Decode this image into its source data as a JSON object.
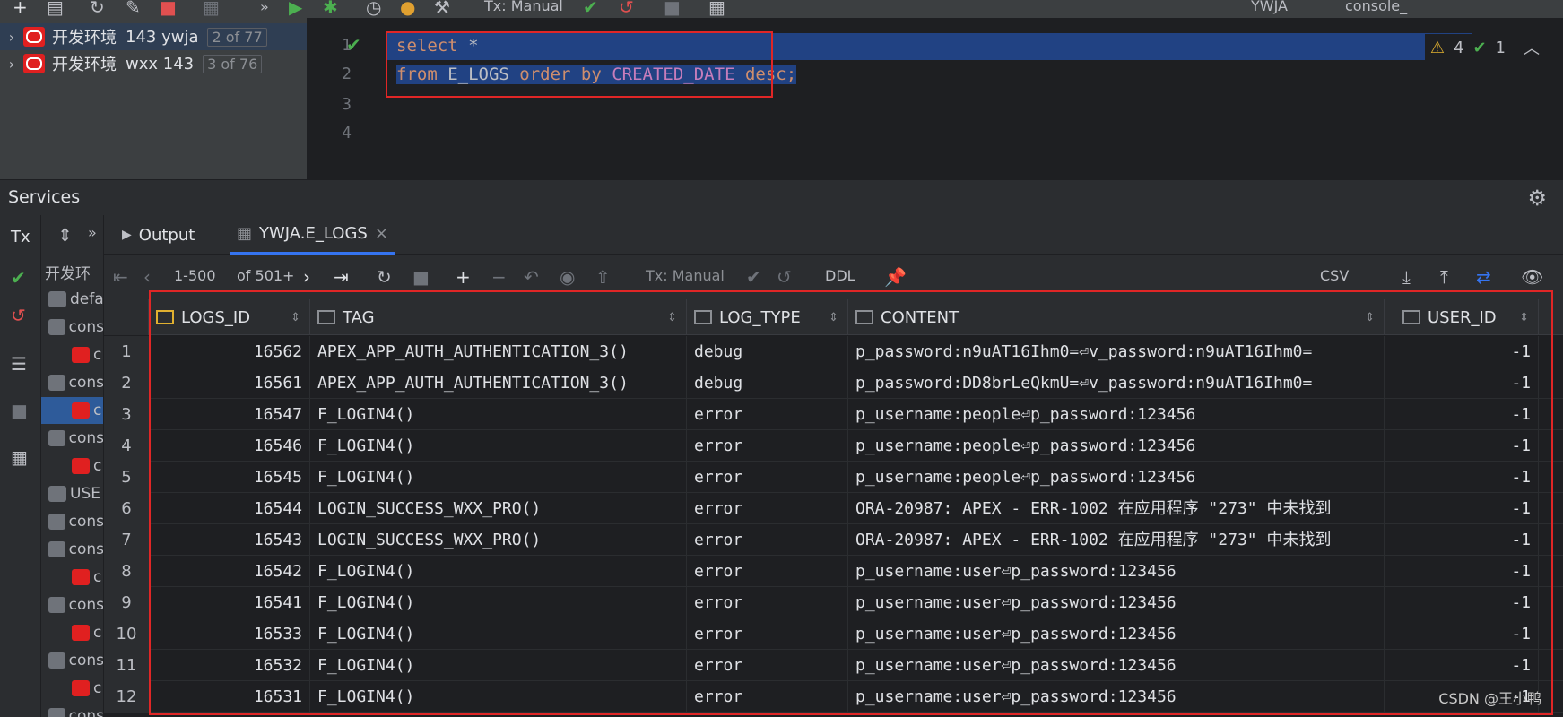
{
  "toolbar": {
    "tx_mode": "Tx: Manual",
    "schema": "YWJA",
    "console": "console_"
  },
  "datasources": [
    {
      "label": "开发环境",
      "user": "143 ywja",
      "count": "2 of 77"
    },
    {
      "label": "开发环境",
      "user": "wxx 143",
      "count": "3 of 76"
    }
  ],
  "editor": {
    "line_numbers": [
      "1",
      "2",
      "3",
      "4"
    ],
    "line1_kw": "select",
    "line1_rest": " *",
    "line2_from": "from",
    "line2_table": " E_LOGS ",
    "line2_order": "order by",
    "line2_col": " CREATED_DATE ",
    "line2_desc": "desc",
    "line2_semi": ";",
    "warnings": "4",
    "ok": "1"
  },
  "services": {
    "title": "Services",
    "tree": [
      {
        "label": "开发环",
        "kind": "text"
      },
      {
        "label": "defa",
        "kind": "plug"
      },
      {
        "label": "cons",
        "kind": "plug"
      },
      {
        "label": "c",
        "kind": "oracle"
      },
      {
        "label": "cons",
        "kind": "plug"
      },
      {
        "label": "c",
        "kind": "oracle",
        "selected": true
      },
      {
        "label": "cons",
        "kind": "plug"
      },
      {
        "label": "c",
        "kind": "oracle"
      },
      {
        "label": "USE",
        "kind": "plug"
      },
      {
        "label": "cons",
        "kind": "plug"
      },
      {
        "label": "cons",
        "kind": "plug"
      },
      {
        "label": "c",
        "kind": "oracle"
      },
      {
        "label": "cons",
        "kind": "plug"
      },
      {
        "label": "c",
        "kind": "oracle"
      },
      {
        "label": "cons",
        "kind": "plug"
      },
      {
        "label": "c",
        "kind": "oracle"
      },
      {
        "label": "cons",
        "kind": "plug"
      }
    ]
  },
  "tabs": {
    "output": "Output",
    "result": "YWJA.E_LOGS"
  },
  "result_toolbar": {
    "range": "1-500",
    "total": "of 501+",
    "tx_mode": "Tx: Manual",
    "ddl": "DDL",
    "export": "CSV"
  },
  "grid": {
    "columns": [
      "LOGS_ID",
      "TAG",
      "LOG_TYPE",
      "CONTENT",
      "USER_ID"
    ],
    "rows": [
      {
        "n": "1",
        "id": "16562",
        "tag": "APEX_APP_AUTH_AUTHENTICATION_3()",
        "type": "debug",
        "content": "p_password:n9uAT16Ihm0=⏎v_password:n9uAT16Ihm0=",
        "user": "-1"
      },
      {
        "n": "2",
        "id": "16561",
        "tag": "APEX_APP_AUTH_AUTHENTICATION_3()",
        "type": "debug",
        "content": "p_password:DD8brLeQkmU=⏎v_password:n9uAT16Ihm0=",
        "user": "-1"
      },
      {
        "n": "3",
        "id": "16547",
        "tag": "F_LOGIN4()",
        "type": "error",
        "content": "p_username:people⏎p_password:123456",
        "user": "-1"
      },
      {
        "n": "4",
        "id": "16546",
        "tag": "F_LOGIN4()",
        "type": "error",
        "content": "p_username:people⏎p_password:123456",
        "user": "-1"
      },
      {
        "n": "5",
        "id": "16545",
        "tag": "F_LOGIN4()",
        "type": "error",
        "content": "p_username:people⏎p_password:123456",
        "user": "-1"
      },
      {
        "n": "6",
        "id": "16544",
        "tag": "LOGIN_SUCCESS_WXX_PRO()",
        "type": "error",
        "content": "ORA-20987: APEX - ERR-1002 在应用程序 \"273\" 中未找到",
        "user": "-1"
      },
      {
        "n": "7",
        "id": "16543",
        "tag": "LOGIN_SUCCESS_WXX_PRO()",
        "type": "error",
        "content": "ORA-20987: APEX - ERR-1002 在应用程序 \"273\" 中未找到",
        "user": "-1"
      },
      {
        "n": "8",
        "id": "16542",
        "tag": "F_LOGIN4()",
        "type": "error",
        "content": "p_username:user⏎p_password:123456",
        "user": "-1"
      },
      {
        "n": "9",
        "id": "16541",
        "tag": "F_LOGIN4()",
        "type": "error",
        "content": "p_username:user⏎p_password:123456",
        "user": "-1"
      },
      {
        "n": "10",
        "id": "16533",
        "tag": "F_LOGIN4()",
        "type": "error",
        "content": "p_username:user⏎p_password:123456",
        "user": "-1"
      },
      {
        "n": "11",
        "id": "16532",
        "tag": "F_LOGIN4()",
        "type": "error",
        "content": "p_username:user⏎p_password:123456",
        "user": "-1"
      },
      {
        "n": "12",
        "id": "16531",
        "tag": "F_LOGIN4()",
        "type": "error",
        "content": "p_username:user⏎p_password:123456",
        "user": "-1"
      }
    ]
  },
  "watermark": "CSDN @王小鸭",
  "colors": {
    "accent": "#3574f0",
    "highlight": "#e02626",
    "selection": "#214283"
  }
}
